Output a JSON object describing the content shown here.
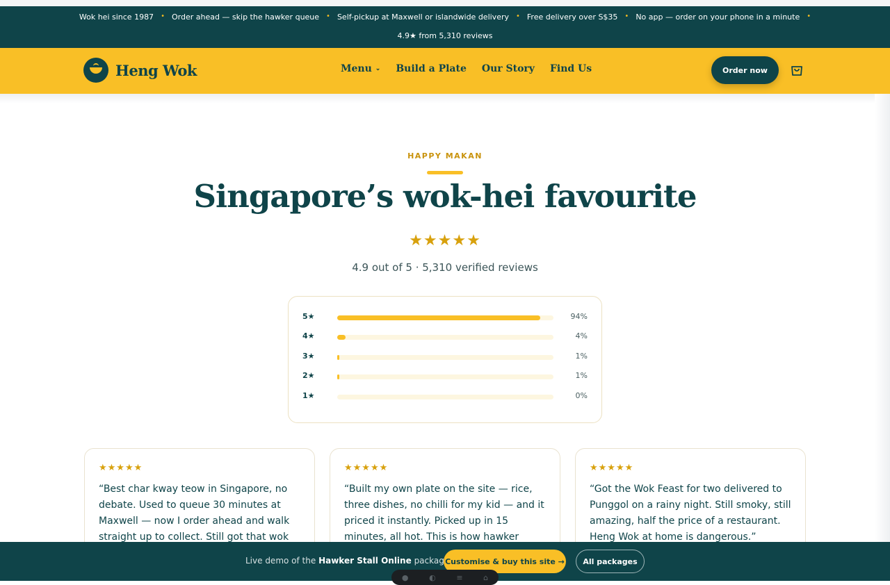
{
  "announcement": {
    "items": [
      "Wok hei since 1987",
      "Order ahead — skip the hawker queue",
      "Self-pickup at Maxwell or islandwide delivery",
      "Free delivery over S$35",
      "No app — order on your phone in a minute"
    ],
    "separator": "•",
    "rating_line": "4.9★ from 5,310 reviews"
  },
  "nav": {
    "brand": "Heng Wok",
    "menu_items": [
      "Menu",
      "Build a Plate",
      "Our Story",
      "Find Us"
    ],
    "order_label": "Order now"
  },
  "reviews": {
    "eyebrow": "HAPPY MAKAN",
    "title": "Singapore’s wok-hei favourite",
    "stars": "★★★★★",
    "summary": "4.9 out of 5 · 5,310 verified reviews",
    "distribution": [
      {
        "label": "5★",
        "percent": 94,
        "percent_text": "94%"
      },
      {
        "label": "4★",
        "percent": 4,
        "percent_text": "4%"
      },
      {
        "label": "3★",
        "percent": 1,
        "percent_text": "1%"
      },
      {
        "label": "2★",
        "percent": 1,
        "percent_text": "1%"
      },
      {
        "label": "1★",
        "percent": 0,
        "percent_text": "0%"
      }
    ],
    "cards": [
      {
        "stars": "★★★★★",
        "quote": "“Best char kway teow in Singapore, no debate. Used to queue 30 minutes at Maxwell — now I order ahead and walk straight up to collect. Still got that wok"
      },
      {
        "stars": "★★★★★",
        "quote": "“Built my own plate on the site — rice, three dishes, no chilli for my kid — and it priced it instantly. Picked up in 15 minutes, all hot. This is how hawker"
      },
      {
        "stars": "★★★★★",
        "quote": "“Got the Wok Feast for two delivered to Punggol on a rainy night. Still smoky, still amazing, half the price of a restaurant. Heng Wok at home is dangerous.”"
      }
    ]
  },
  "demo_bar": {
    "text_prefix": "Live demo of the",
    "package_name": "Hawker Stall Online",
    "text_suffix": "package.",
    "customise_label": "Customise & buy this site →",
    "all_label": "All packages"
  },
  "colors": {
    "brand_dark": "#0f4449",
    "brand_yellow": "#f9bf26",
    "star": "#d8a10d"
  }
}
